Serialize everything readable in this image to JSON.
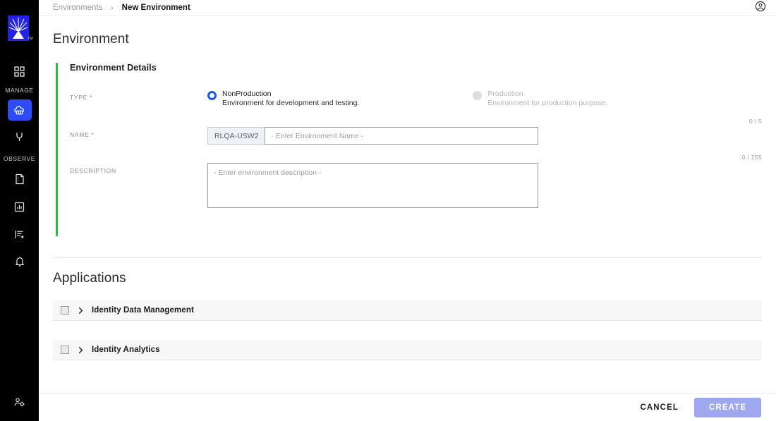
{
  "sidebar": {
    "logo": {
      "name": "cloudera-logo",
      "trademark": "TM",
      "color": "#2323e8"
    },
    "groups": [
      {
        "label": "MANAGE",
        "items": [
          {
            "icon": "grid-dashboard-icon",
            "name": "dashboard",
            "active": false
          },
          {
            "icon": "cloud-environment-icon",
            "name": "environments",
            "active": true
          },
          {
            "icon": "power-plug-icon",
            "name": "data-services",
            "active": false
          }
        ]
      },
      {
        "label": "OBSERVE",
        "items": [
          {
            "icon": "document-icon",
            "name": "reports",
            "active": false
          },
          {
            "icon": "chart-square-icon",
            "name": "analytics",
            "active": false
          },
          {
            "icon": "list-add-icon",
            "name": "jobs",
            "active": false
          },
          {
            "icon": "bell-icon",
            "name": "alerts",
            "active": false
          }
        ]
      }
    ],
    "bottom": {
      "icon": "user-settings-icon",
      "name": "user-management"
    },
    "active_color": "#2d4bf7"
  },
  "topbar": {
    "breadcrumb": {
      "parent": "Environments",
      "separator": "›",
      "current": "New Environment"
    },
    "account_icon": "account-circle-icon"
  },
  "page": {
    "title": "Environment"
  },
  "environment_details": {
    "card_title": "Environment Details",
    "accent_color": "#15d023",
    "type": {
      "label": "TYPE *",
      "options": [
        {
          "title": "NonProduction",
          "description": "Environment for development and testing.",
          "selected": true,
          "disabled": false
        },
        {
          "title": "Production",
          "description": "Environment for production purpose.",
          "selected": false,
          "disabled": true
        }
      ]
    },
    "name": {
      "label": "NAME *",
      "counter": "0 / 5",
      "prefix": "RLQA-USW2",
      "value": "",
      "placeholder": "- Enter Environment Name -"
    },
    "description": {
      "label": "DESCRIPTION",
      "counter": "0 / 255",
      "value": "",
      "placeholder": "- Enter environment description -"
    }
  },
  "applications": {
    "title": "Applications",
    "rows": [
      {
        "name": "Identity Data Management",
        "checked": false,
        "expanded": false
      },
      {
        "name": "Identity Analytics",
        "checked": false,
        "expanded": false
      }
    ]
  },
  "footer": {
    "cancel_label": "CANCEL",
    "create_label": "CREATE",
    "create_disabled": true,
    "create_color": "#9fa8ef"
  }
}
